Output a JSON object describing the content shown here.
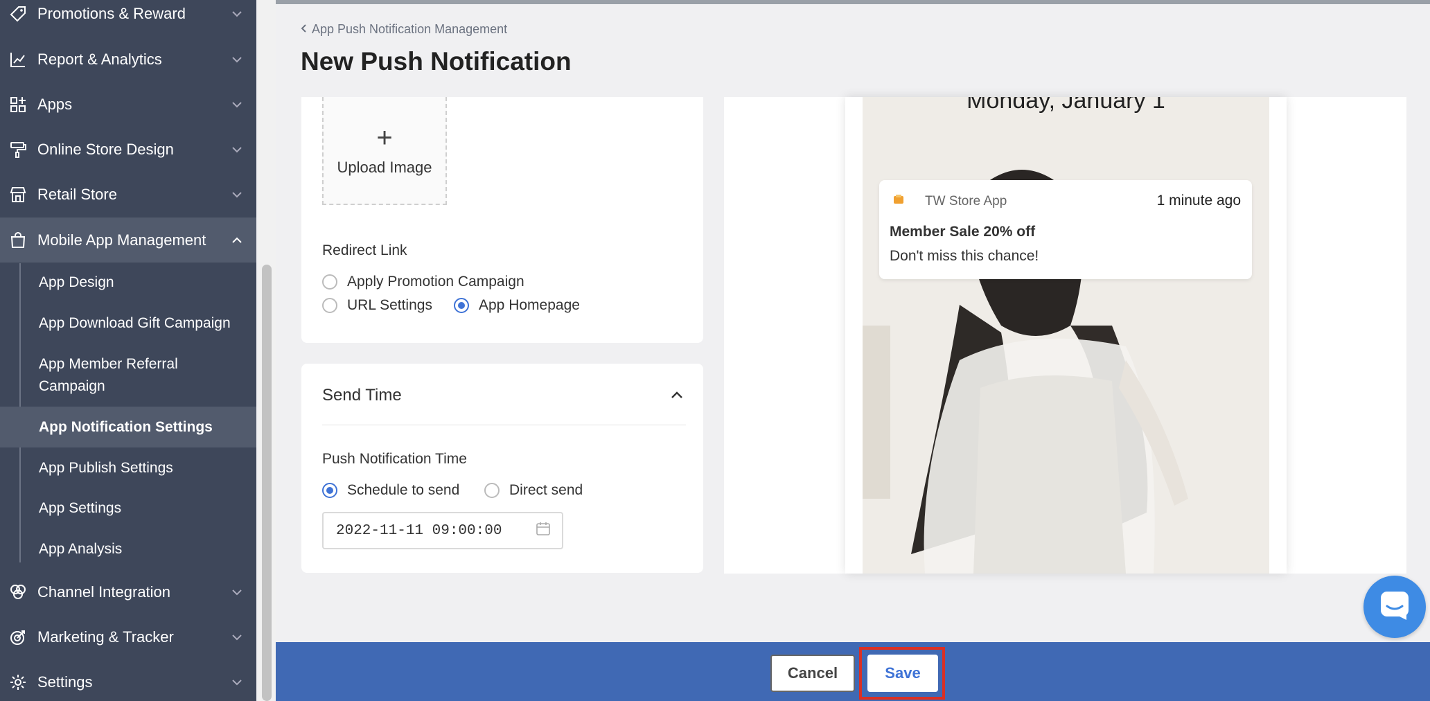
{
  "sidebar": {
    "items": [
      {
        "label": "Promotions & Reward",
        "icon": "tag-icon"
      },
      {
        "label": "Report & Analytics",
        "icon": "chart-icon"
      },
      {
        "label": "Apps",
        "icon": "apps-grid-icon"
      },
      {
        "label": "Online Store Design",
        "icon": "paint-roller-icon"
      },
      {
        "label": "Retail Store",
        "icon": "store-icon"
      },
      {
        "label": "Mobile App Management",
        "icon": "shopping-bag-icon"
      },
      {
        "label": "Channel Integration",
        "icon": "channels-icon"
      },
      {
        "label": "Marketing & Tracker",
        "icon": "target-icon"
      },
      {
        "label": "Settings",
        "icon": "gear-icon"
      }
    ],
    "subitems": [
      "App Design",
      "App Download Gift Campaign",
      "App Member Referral",
      "Campaign",
      "App Notification Settings",
      "App Publish Settings",
      "App Settings",
      "App Analysis"
    ]
  },
  "header": {
    "breadcrumb": "App Push Notification Management",
    "title": "New Push Notification"
  },
  "form": {
    "upload_label": "Upload Image",
    "upload_plus": "+",
    "redirect_label": "Redirect Link",
    "redirect_options": [
      "Apply Promotion Campaign",
      "URL Settings",
      "App Homepage"
    ],
    "redirect_selected": "App Homepage",
    "send_time_title": "Send Time",
    "push_time_label": "Push Notification Time",
    "push_time_options": [
      "Schedule to send",
      "Direct send"
    ],
    "push_time_selected": "Schedule to send",
    "datetime_value": "2022-11-11 09:00:00"
  },
  "preview": {
    "date": "Monday, January 1",
    "app_name": "TW Store App",
    "time_ago": "1 minute ago",
    "notif_title": "Member Sale 20% off",
    "notif_body": "Don't miss this chance!"
  },
  "footer": {
    "cancel_label": "Cancel",
    "save_label": "Save"
  },
  "colors": {
    "sidebar_bg": "#3e475a",
    "accent": "#3f73d6",
    "bottom_bar": "#4069b4",
    "highlight": "#d93025"
  }
}
